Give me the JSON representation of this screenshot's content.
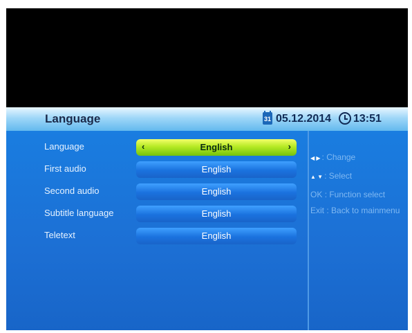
{
  "header": {
    "title": "Language",
    "date": "05.12.2014",
    "time": "13:51"
  },
  "settings": [
    {
      "label": "Language",
      "value": "English",
      "selected": true
    },
    {
      "label": "First audio",
      "value": "English",
      "selected": false
    },
    {
      "label": "Second audio",
      "value": "English",
      "selected": false
    },
    {
      "label": "Subtitle language",
      "value": "English",
      "selected": false
    },
    {
      "label": "Teletext",
      "value": "English",
      "selected": false
    }
  ],
  "help": {
    "change": ": Change",
    "select": ": Select",
    "ok_key": "OK",
    "ok_text": ": Function select",
    "exit_key": "Exit",
    "exit_text": ": Back to mainmenu"
  },
  "selector_arrows": {
    "left": "‹",
    "right": "›"
  },
  "colors": {
    "background": "#1c6fd4",
    "selected_field": "#b6ea24",
    "header": "#9fd7f8"
  }
}
